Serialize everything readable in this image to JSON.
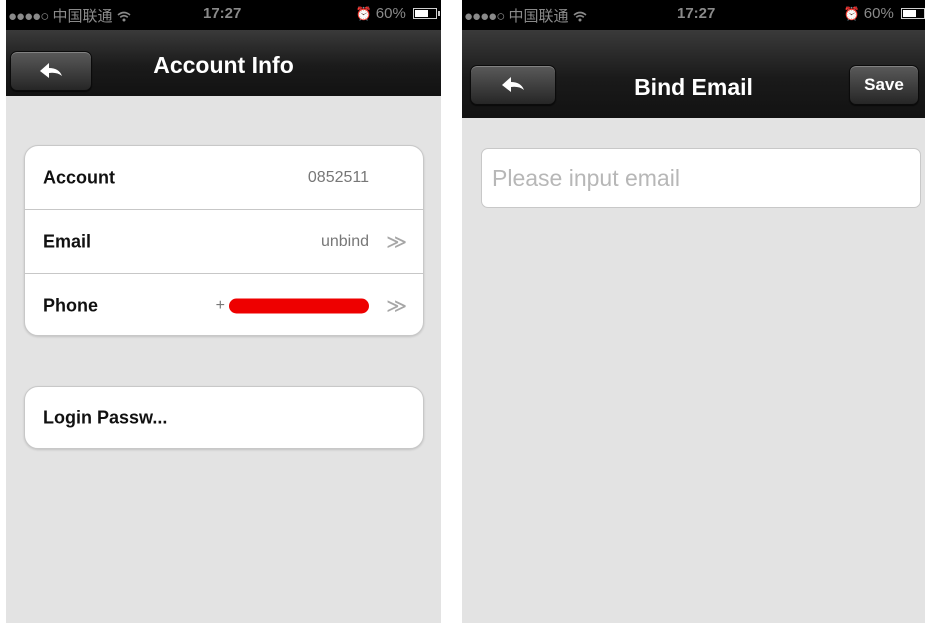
{
  "status_bar": {
    "signal": "●●●●○",
    "carrier": "中国联通",
    "time": "17:27",
    "battery": "60%"
  },
  "account_info_screen": {
    "title": "Account Info",
    "rows": [
      {
        "label": "Account",
        "value": "0852511"
      },
      {
        "label": "Email",
        "value": "unbind",
        "arrow": "≫"
      },
      {
        "label": "Phone",
        "value_prefix": "+",
        "value_redacted": true,
        "arrow": "≫"
      }
    ],
    "password_row": {
      "label": "Login Passw..."
    }
  },
  "bind_email_screen": {
    "title": "Bind Email",
    "save_label": "Save",
    "email_input": {
      "placeholder": "Please input email",
      "value": ""
    }
  },
  "colors": {
    "navbar": "#1a1a1a",
    "background": "#e3e3e3",
    "redaction": "#ee0000"
  },
  "icons": {
    "back": "back-arrow-icon",
    "wifi": "wifi-icon",
    "alarm": "alarm-icon",
    "battery": "battery-icon",
    "row_arrow": "double-chevron-right-icon"
  }
}
